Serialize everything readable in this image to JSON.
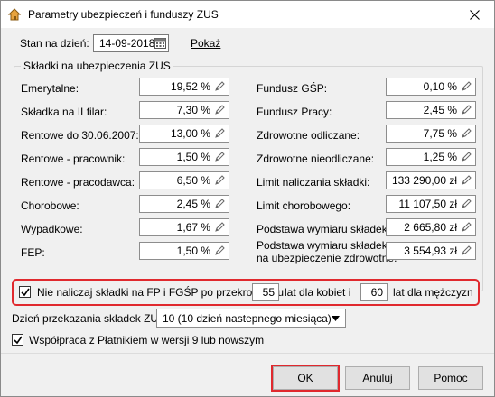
{
  "window": {
    "title": "Parametry ubezpieczeń i funduszy ZUS"
  },
  "date_row": {
    "label": "Stan na dzień:",
    "value": "14-09-2018",
    "link": "Pokaż"
  },
  "group": {
    "title": "Składki na ubezpieczenia ZUS"
  },
  "left_fields": [
    {
      "label": "Emerytalne:",
      "value": "19,52 %"
    },
    {
      "label": "Składka na II filar:",
      "value": "7,30 %"
    },
    {
      "label": "Rentowe do 30.06.2007:",
      "value": "13,00 %"
    },
    {
      "label": "Rentowe - pracownik:",
      "value": "1,50 %"
    },
    {
      "label": "Rentowe - pracodawca:",
      "value": "6,50 %"
    },
    {
      "label": "Chorobowe:",
      "value": "2,45 %"
    },
    {
      "label": "Wypadkowe:",
      "value": "1,67 %"
    },
    {
      "label": "FEP:",
      "value": "1,50 %"
    }
  ],
  "right_fields": [
    {
      "label": "Fundusz GŚP:",
      "value": "0,10 %"
    },
    {
      "label": "Fundusz Pracy:",
      "value": "2,45 %"
    },
    {
      "label": "Zdrowotne odliczane:",
      "value": "7,75 %"
    },
    {
      "label": "Zdrowotne nieodliczane:",
      "value": "1,25 %"
    },
    {
      "label": "Limit naliczania składki:",
      "value": "133 290,00 zł"
    },
    {
      "label": "Limit chorobowego:",
      "value": "11 107,50 zł"
    },
    {
      "label": "Podstawa wymiaru składek:",
      "value": "2 665,80 zł"
    },
    {
      "label_line1": "Podstawa wymiaru składek",
      "label_line2": "na ubezpieczenie zdrowotne:",
      "value": "3 554,93 zł"
    }
  ],
  "fp_check": {
    "checked": true,
    "label": "Nie naliczaj składki na FP i FGŚP po przekroczeniu",
    "women_age": "55",
    "women_label": "lat dla kobiet i",
    "men_age": "60",
    "men_label": "lat dla mężczyzn"
  },
  "transfer_day": {
    "label": "Dzień przekazania składek ZUS:",
    "value": "10 (10 dzień nastepnego miesiąca)"
  },
  "platnik_check": {
    "checked": true,
    "label": "Współpraca z Płatnikiem w wersji 9 lub nowszym"
  },
  "buttons": {
    "ok": "OK",
    "cancel": "Anuluj",
    "help": "Pomoc"
  },
  "icons": {
    "app": "app-home-icon",
    "close": "close-icon",
    "calendar": "calendar-icon",
    "edit": "pencil-icon",
    "dropdown": "chevron-down-icon",
    "check": "checkmark-icon"
  },
  "colors": {
    "highlight": "#e0292e",
    "background": "#f0f0f0"
  }
}
